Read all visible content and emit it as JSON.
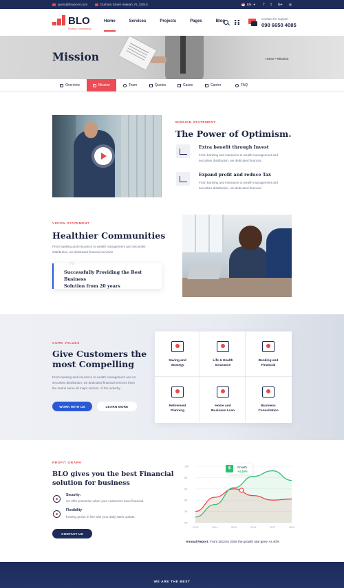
{
  "topbar": {
    "email": "query@finances.com",
    "address": "Durham Street Hialeah, FL 33010",
    "lang": "EN",
    "social": [
      "f",
      "t",
      "G+",
      "◎"
    ]
  },
  "header": {
    "logo": "BLO",
    "logo_sub": "Finance Consultancy",
    "nav": [
      "Home",
      "Services",
      "Projects",
      "Pages",
      "Blog"
    ],
    "support_label": "Contact for support",
    "support_phone": "098 6650 4085"
  },
  "banner": {
    "title": "Mission",
    "breadcrumb": "Home  •  Mission"
  },
  "tabs": [
    "Overview",
    "Mission",
    "Team",
    "Quotes",
    "Cases",
    "Carrier",
    "FAQ"
  ],
  "mission": {
    "kicker": "MISSION STATEMENT",
    "title": "The Power of Optimism.",
    "features": [
      {
        "title": "Extra benefit through Invest",
        "l1": "From banking and  insurance to wealth management and",
        "l2": "securities distribution, we dedicated financial"
      },
      {
        "title": "Expand profit and reduce Tax",
        "l1": "From banking and  insurance to wealth management and",
        "l2": "securities distribution, we dedicated financial"
      }
    ]
  },
  "vision": {
    "kicker": "VISION STATEMENT",
    "title": "Healthier Communities",
    "l1": "From banking and  insurance to wealth management and securities",
    "l2": "distribution, we dedicated financial services",
    "quote_l1": "Successfully Providing the Best Business",
    "quote_l2": "Solution from 20 years"
  },
  "core": {
    "kicker": "CORE VALUES",
    "title_l1": "Give Customers the",
    "title_l2": "most Compelling",
    "l1": "From banking and  insurance to wealth management and on",
    "l2": "securities distribution, we dedicated financial services them",
    "l3": "the teams serve all major sectors. of the industry.",
    "btn_primary": "WORK WITH US",
    "btn_secondary": "LEARN MORE",
    "values": [
      {
        "l1": "Saving and",
        "l2": "Strategy"
      },
      {
        "l1": "Life & Health",
        "l2": "Insurance"
      },
      {
        "l1": "Banking and",
        "l2": "Financial"
      },
      {
        "l1": "Retirement",
        "l2": "Planning"
      },
      {
        "l1": "Home and",
        "l2": "Business Loan"
      },
      {
        "l1": "Business",
        "l2": "Consultation"
      }
    ]
  },
  "profit": {
    "kicker": "PROFIT GRAPH",
    "title_l1": "BLO gives you the best Financial",
    "title_l2": "solution for business",
    "items": [
      {
        "title": "Security:",
        "desc": "we offer protection when your customers have financial."
      },
      {
        "title": "Flexibility",
        "desc": "funding grows in line with your daily sales update."
      }
    ],
    "button": "CONTACT US",
    "report_label": "Annual Report:",
    "report_text": " From 2013 to 2018 the growth rate grew +2.40%"
  },
  "chart_data": {
    "type": "area",
    "x": [
      "2013",
      "2014",
      "2015",
      "2016",
      "2017",
      "2018"
    ],
    "y_ticks": [
      "10K",
      "8K",
      "6K",
      "4K",
      "2K",
      "0K"
    ],
    "ylim": [
      0,
      10
    ],
    "series": [
      {
        "values": [
          2.0,
          4.5,
          6.0,
          4.8,
          4.0,
          4.2
        ],
        "color": "#e84949"
      },
      {
        "values": [
          1.0,
          3.2,
          6.2,
          8.2,
          9.2,
          7.5
        ],
        "color": "#2dbf6f"
      }
    ],
    "legend": {
      "label": "Growth",
      "value": "+4.48%",
      "badge": "$"
    }
  },
  "footer": {
    "text": "WE ARE THE BEST"
  }
}
